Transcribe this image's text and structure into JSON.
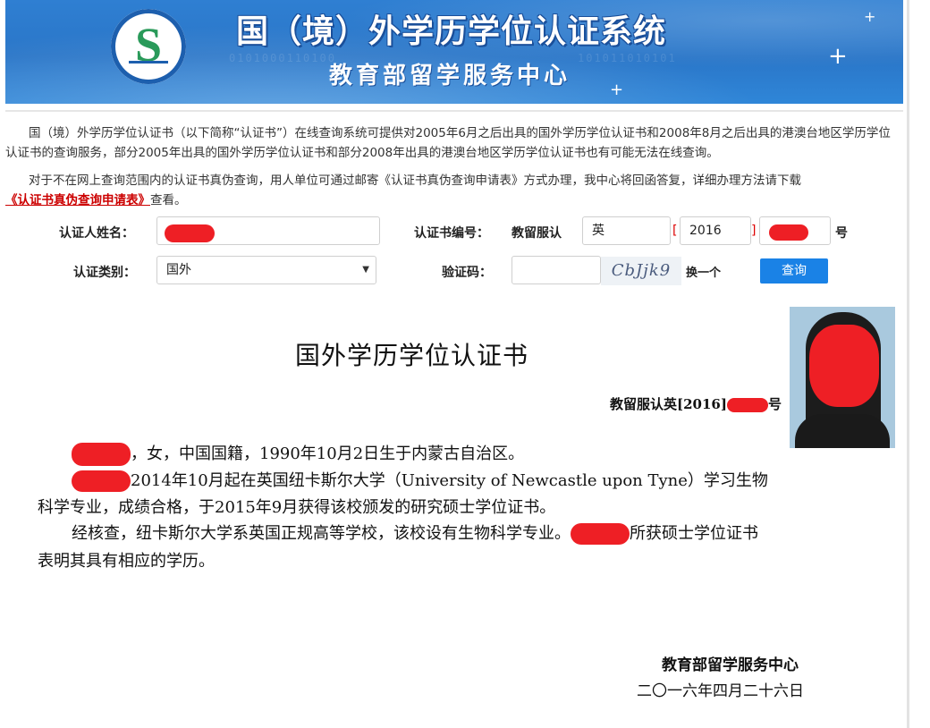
{
  "header": {
    "title": "国（境）外学历学位认证系统",
    "subtitle": "教育部留学服务中心"
  },
  "intro": {
    "para1": "国（境）外学历学位认证书（以下简称“认证书”）在线查询系统可提供对2005年6月之后出具的国外学历学位认证书和2008年8月之后出具的港澳台地区学历学位认证书的查询服务，部分2005年出具的国外学历学位认证书和部分2008年出具的港澳台地区学历学位认证书也有可能无法在线查询。",
    "para2_text": "对于不在网上查询范围内的认证书真伪查询，用人单位可通过邮寄《认证书真伪查询申请表》方式办理，我中心将回函答复，详细办理方法请下载",
    "para2_link": "《认证书真伪查询申请表》",
    "para2_tail": "查看。"
  },
  "form": {
    "name_label": "认证人姓名：",
    "cert_no_label": "认证书编号：",
    "cert_prefix": "教留服认",
    "country_value": "英",
    "bracket_open": "[",
    "year_value": "2016",
    "bracket_close": "]",
    "hao": "号",
    "type_label": "认证类别：",
    "type_value": "国外",
    "captcha_label": "验证码：",
    "captcha_text": "CbJjk9",
    "refresh_label": "换一个",
    "submit_label": "查询"
  },
  "certificate": {
    "title": "国外学历学位认证书",
    "number_prefix": "教留服认英[2016]",
    "number_suffix": "号",
    "line1": "，女，中国国籍，1990年10月2日生于内蒙古自治区。",
    "line2": "2014年10月起在英国纽卡斯尔大学（University of Newcastle upon Tyne）学习生物",
    "line3": "科学专业，成绩合格，于2015年9月获得该校颁发的研究硕士学位证书。",
    "line4a": "经核查，纽卡斯尔大学系英国正规高等学校，该校设有生物科学专业。",
    "line4b": "所获硕士学位证书",
    "line5": "表明其具有相应的学历。",
    "issuer": "教育部留学服务中心",
    "date": "二〇一六年四月二十六日"
  },
  "colors": {
    "banner_blue": "#2a76c8",
    "redaction": "#ee1f25",
    "button_blue": "#1a82e6",
    "link_red": "#cc0000"
  }
}
